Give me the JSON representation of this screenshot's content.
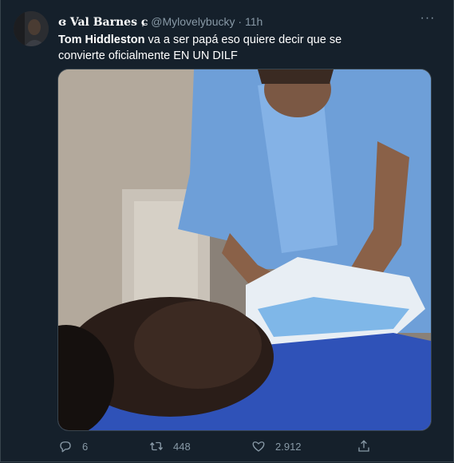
{
  "tweet": {
    "display_name": "ɞ Val Barnes ɕ",
    "handle": "@Mylovelybucky",
    "separator": "·",
    "time": "11h",
    "more_label": "···",
    "text_bold": "Tom Hiddleston",
    "text_rest": " va a ser papá eso quiere decir que se convierte oficialmente EN UN DILF"
  },
  "actions": {
    "reply_count": "6",
    "retweet_count": "448",
    "like_count": "2.912"
  },
  "icons": {
    "reply": "reply-icon",
    "retweet": "retweet-icon",
    "like": "heart-icon",
    "share": "share-icon",
    "more": "more-dots-icon"
  },
  "colors": {
    "background": "#15202b",
    "border": "#38444d",
    "secondary_text": "#8899a6",
    "primary_text": "#ffffff"
  }
}
